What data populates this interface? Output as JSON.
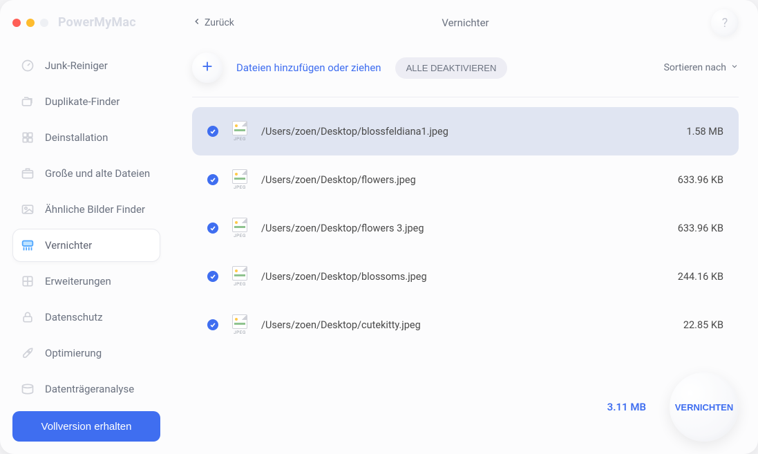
{
  "brand": "PowerMyMac",
  "back_label": "Zurück",
  "page_title": "Vernichter",
  "help_label": "?",
  "sidebar": {
    "items": [
      {
        "label": "Junk-Reiniger",
        "icon": "gauge-icon"
      },
      {
        "label": "Duplikate-Finder",
        "icon": "folders-icon"
      },
      {
        "label": "Deinstallation",
        "icon": "app-grid-icon"
      },
      {
        "label": "Große und alte Dateien",
        "icon": "box-icon"
      },
      {
        "label": "Ähnliche Bilder Finder",
        "icon": "image-icon"
      },
      {
        "label": "Vernichter",
        "icon": "shredder-icon"
      },
      {
        "label": "Erweiterungen",
        "icon": "puzzle-icon"
      },
      {
        "label": "Datenschutz",
        "icon": "lock-icon"
      },
      {
        "label": "Optimierung",
        "icon": "rocket-icon"
      },
      {
        "label": "Datenträgeranalyse",
        "icon": "disk-icon"
      }
    ],
    "active_index": 5,
    "full_button": "Vollversion erhalten"
  },
  "toolbar": {
    "add_text": "Dateien hinzufügen oder ziehen",
    "deactivate_all": "ALLE DEAKTIVIEREN",
    "sort_label": "Sortieren nach"
  },
  "files": [
    {
      "checked": true,
      "selected": true,
      "ext": "JPEG",
      "path": "/Users/zoen/Desktop/blossfeldiana1.jpeg",
      "size": "1.58 MB"
    },
    {
      "checked": true,
      "selected": false,
      "ext": "JPEG",
      "path": "/Users/zoen/Desktop/flowers.jpeg",
      "size": "633.96 KB"
    },
    {
      "checked": true,
      "selected": false,
      "ext": "JPEG",
      "path": "/Users/zoen/Desktop/flowers 3.jpeg",
      "size": "633.96 KB"
    },
    {
      "checked": true,
      "selected": false,
      "ext": "JPEG",
      "path": "/Users/zoen/Desktop/blossoms.jpeg",
      "size": "244.16 KB"
    },
    {
      "checked": true,
      "selected": false,
      "ext": "JPEG",
      "path": "/Users/zoen/Desktop/cutekitty.jpeg",
      "size": "22.85 KB"
    }
  ],
  "footer": {
    "total_size": "3.11 MB",
    "action": "VERNICHTEN"
  }
}
